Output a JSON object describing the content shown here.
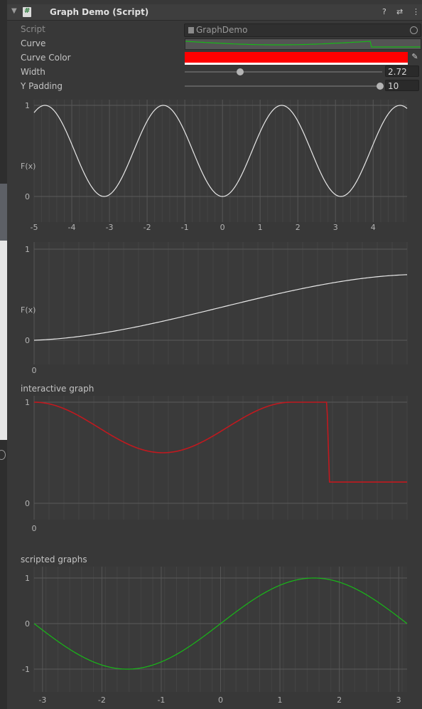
{
  "header": {
    "title": "Graph Demo (Script)",
    "icons": [
      "script-icon",
      "help-icon",
      "preset-icon",
      "menu-icon"
    ]
  },
  "properties": {
    "script": {
      "label": "Script",
      "value": "GraphDemo"
    },
    "curve": {
      "label": "Curve"
    },
    "curve_color": {
      "label": "Curve Color",
      "value": "#FF0000"
    },
    "width": {
      "label": "Width",
      "value": "2.72",
      "fraction": 0.28
    },
    "y_padding": {
      "label": "Y Padding",
      "value": "10",
      "fraction": 1.0
    }
  },
  "colors": {
    "panel": "#383838",
    "curve_white": "#e8e8e8",
    "curve_red": "#c0191f",
    "curve_green": "#18b818"
  },
  "graph1": {
    "y_label": "F(x)",
    "x_ticks": [
      "-5",
      "-4",
      "-3",
      "-2",
      "-1",
      "0",
      "1",
      "2",
      "3",
      "4"
    ],
    "y_ticks": [
      "1",
      "0"
    ]
  },
  "graph2": {
    "y_label": "F(x)",
    "x_ticks": [
      "0"
    ],
    "y_ticks": [
      "1",
      "0"
    ]
  },
  "graph3": {
    "title": "interactive graph",
    "x_ticks": [
      "0"
    ],
    "y_ticks": [
      "1",
      "0"
    ]
  },
  "graph4": {
    "title": "scripted graphs",
    "x_ticks": [
      "-3",
      "-2",
      "-1",
      "0",
      "1",
      "2",
      "3"
    ],
    "y_ticks": [
      "1",
      "0",
      "-1"
    ]
  }
}
